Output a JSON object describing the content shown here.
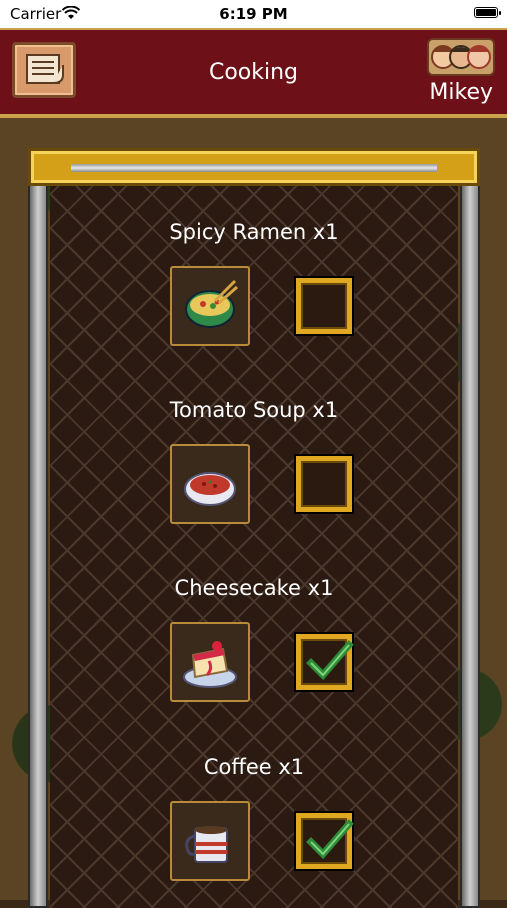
{
  "status_bar": {
    "carrier": "Carrier",
    "time": "6:19 PM"
  },
  "header": {
    "title": "Cooking",
    "username": "Mikey"
  },
  "items": [
    {
      "label": "Spicy Ramen x1",
      "icon": "ramen-bowl-icon",
      "checked": false
    },
    {
      "label": "Tomato Soup x1",
      "icon": "tomato-soup-icon",
      "checked": false
    },
    {
      "label": "Cheesecake x1",
      "icon": "cheesecake-icon",
      "checked": true
    },
    {
      "label": "Coffee x1",
      "icon": "coffee-mug-icon",
      "checked": true
    }
  ],
  "colors": {
    "header_bg": "#6e1018",
    "accent_gold": "#e0a820",
    "check_green": "#2e8b3a"
  }
}
